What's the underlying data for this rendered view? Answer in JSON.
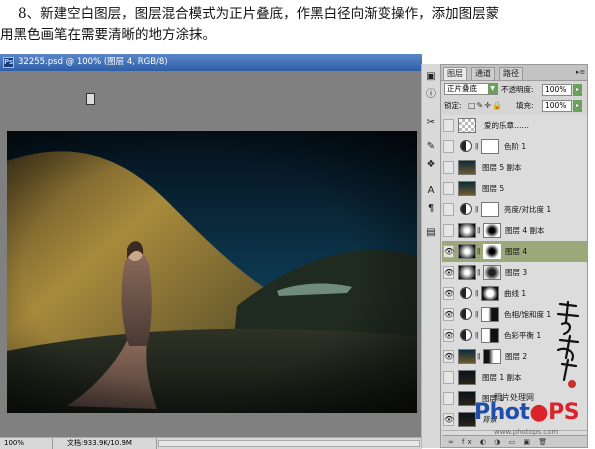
{
  "caption": {
    "line1": "8、新建空白图层，图层混合模式为正片叠底，作黑白径向渐变操作，添加图层蒙",
    "line2": "用黑色画笔在需要清晰的地方涂抹。"
  },
  "document": {
    "title": "32255.psd @ 100% (图层 4, RGB/8)",
    "status_zoom": "100%",
    "status_doc": "文档:933.9K/10.9M"
  },
  "layers_panel": {
    "tabs": [
      "图层",
      "通道",
      "路径"
    ],
    "blend_mode": "正片叠底",
    "opacity_label": "不透明度:",
    "opacity": "100%",
    "lock_label": "锁定:",
    "fill_label": "填充:",
    "fill": "100%",
    "layers": [
      {
        "name": "爱的乐章……",
        "kind": "text",
        "visible": false
      },
      {
        "name": "色阶 1",
        "kind": "adjustment",
        "visible": false
      },
      {
        "name": "图层 5 副本",
        "kind": "image",
        "visible": false
      },
      {
        "name": "图层 5",
        "kind": "image",
        "visible": false
      },
      {
        "name": "亮度/对比度 1",
        "kind": "adjustment",
        "visible": false
      },
      {
        "name": "图层 4 副本",
        "kind": "gradient",
        "visible": false
      },
      {
        "name": "图层 4",
        "kind": "gradient",
        "visible": true,
        "selected": true
      },
      {
        "name": "图层 3",
        "kind": "gradient",
        "visible": true
      },
      {
        "name": "曲线 1",
        "kind": "adjustment",
        "visible": true
      },
      {
        "name": "色相/饱和度 1",
        "kind": "adjustment",
        "visible": true
      },
      {
        "name": "色彩平衡 1",
        "kind": "adjustment",
        "visible": true
      },
      {
        "name": "图层 2",
        "kind": "image",
        "visible": true
      },
      {
        "name": "图层 1 副本",
        "kind": "image",
        "visible": false
      },
      {
        "name": "图层 1",
        "kind": "image",
        "visible": false
      },
      {
        "name": "背景",
        "kind": "background",
        "visible": true
      }
    ]
  },
  "logo": {
    "top_text": "照片处理网",
    "brand": "PhotoPS",
    "url": "www.photops.com"
  },
  "icons": {
    "eye": "eye-icon",
    "link": "chain-link-icon",
    "adjustment": "adjustment-circle-icon",
    "lock": "lock-icon"
  },
  "colors": {
    "title_bar": "#2f5fa8",
    "selected_layer": "#9aa87a",
    "logo_red": "#d8242a",
    "logo_blue": "#1f4fa8"
  }
}
